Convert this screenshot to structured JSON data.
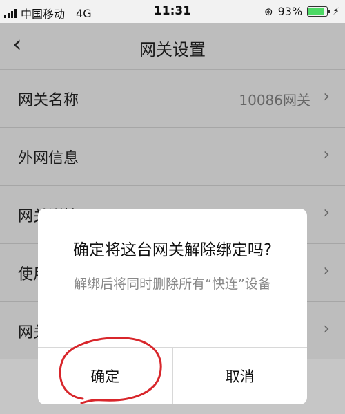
{
  "status_bar": {
    "carrier": "中国移动",
    "network": "4G",
    "time": "11:31",
    "battery_percent": "93%",
    "battery_level": 0.93,
    "accent_color": "#4cd964"
  },
  "nav": {
    "back_icon": "chevron-left-icon",
    "title": "网关设置"
  },
  "list": [
    {
      "label": "网关名称",
      "value": "10086网关"
    },
    {
      "label": "外网信息",
      "value": ""
    },
    {
      "label": "网关详情",
      "value": ""
    },
    {
      "label": "使用",
      "value": ""
    },
    {
      "label": "网关",
      "value": ""
    }
  ],
  "dialog": {
    "title": "确定将这台网关解除绑定吗?",
    "message": "解绑后将同时删除所有“快连”设备",
    "confirm": "确定",
    "cancel": "取消"
  }
}
